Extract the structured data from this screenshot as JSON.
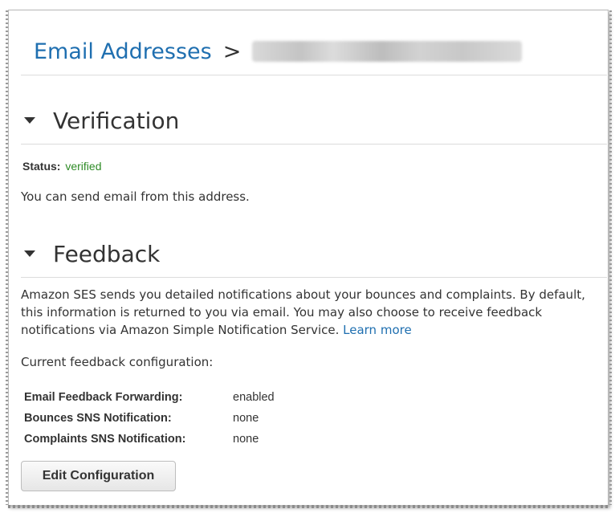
{
  "breadcrumb": {
    "root_label": "Email Addresses",
    "separator": ">"
  },
  "verification": {
    "title": "Verification",
    "status_label": "Status:",
    "status_value": "verified",
    "message": "You can send email from this address."
  },
  "feedback": {
    "title": "Feedback",
    "description": "Amazon SES sends you detailed notifications about your bounces and complaints. By default, this information is returned to you via email. You may also choose to receive feedback notifications via Amazon Simple Notification Service.",
    "learn_more": "Learn more",
    "current_config_label": "Current feedback configuration:",
    "config": [
      {
        "key": "Email Feedback Forwarding:",
        "value": "enabled"
      },
      {
        "key": "Bounces SNS Notification:",
        "value": "none"
      },
      {
        "key": "Complaints SNS Notification:",
        "value": "none"
      }
    ],
    "edit_button": "Edit Configuration"
  },
  "colors": {
    "link": "#1f6fb0",
    "status_verified": "#2e8b26",
    "text": "#333333"
  },
  "icons": {
    "section_toggle": "triangle-down-icon"
  }
}
